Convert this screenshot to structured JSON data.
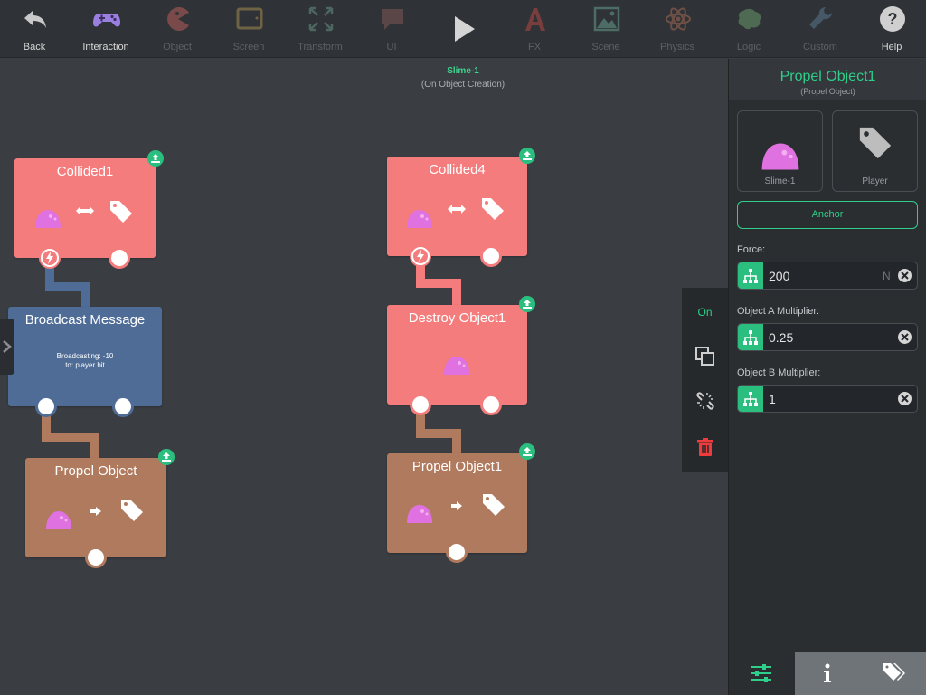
{
  "toolbar": {
    "items": [
      {
        "label": "Back",
        "icon": "back-arrow-icon",
        "enabled": true
      },
      {
        "label": "Interaction",
        "icon": "gamepad-icon",
        "enabled": true
      },
      {
        "label": "Object",
        "icon": "pacman-icon",
        "enabled": false
      },
      {
        "label": "Screen",
        "icon": "screen-icon",
        "enabled": false
      },
      {
        "label": "Transform",
        "icon": "transform-icon",
        "enabled": false
      },
      {
        "label": "UI",
        "icon": "speech-bubble-icon",
        "enabled": false
      },
      {
        "label": "",
        "icon": "play-icon",
        "enabled": true
      },
      {
        "label": "FX",
        "icon": "fx-icon",
        "enabled": false
      },
      {
        "label": "Scene",
        "icon": "landscape-icon",
        "enabled": false
      },
      {
        "label": "Physics",
        "icon": "atom-icon",
        "enabled": false
      },
      {
        "label": "Logic",
        "icon": "brain-icon",
        "enabled": false
      },
      {
        "label": "Custom",
        "icon": "wrench-icon",
        "enabled": false
      },
      {
        "label": "Help",
        "icon": "help-icon",
        "enabled": true
      }
    ]
  },
  "canvas": {
    "scene_title": "Slime-1",
    "scene_subtitle": "(On Object Creation)",
    "nodes": {
      "collided1": {
        "title": "Collided1"
      },
      "broadcast": {
        "title": "Broadcast Message",
        "line1": "Broadcasting: -10",
        "line2": "to: player hit"
      },
      "propel_object": {
        "title": "Propel Object"
      },
      "collided4": {
        "title": "Collided4"
      },
      "destroy": {
        "title": "Destroy Object1"
      },
      "propel_object1": {
        "title": "Propel Object1"
      }
    }
  },
  "side_actions": {
    "on_label": "On"
  },
  "panel": {
    "title": "Propel Object1",
    "subtitle": "(Propel Object)",
    "targets": [
      {
        "label": "Slime-1",
        "icon": "slime-icon"
      },
      {
        "label": "Player",
        "icon": "tag-icon"
      }
    ],
    "anchor_label": "Anchor",
    "fields": [
      {
        "label": "Force:",
        "value": "200",
        "unit": "N"
      },
      {
        "label": "Object A Multiplier:",
        "value": "0.25",
        "unit": ""
      },
      {
        "label": "Object B Multiplier:",
        "value": "1",
        "unit": ""
      }
    ],
    "tabs": [
      "sliders-icon",
      "info-icon",
      "tags-icon"
    ]
  },
  "colors": {
    "accent_green": "#2ecf8a",
    "node_red": "#f47c7c",
    "node_blue": "#4e6c96",
    "node_brown": "#b07a5e"
  }
}
